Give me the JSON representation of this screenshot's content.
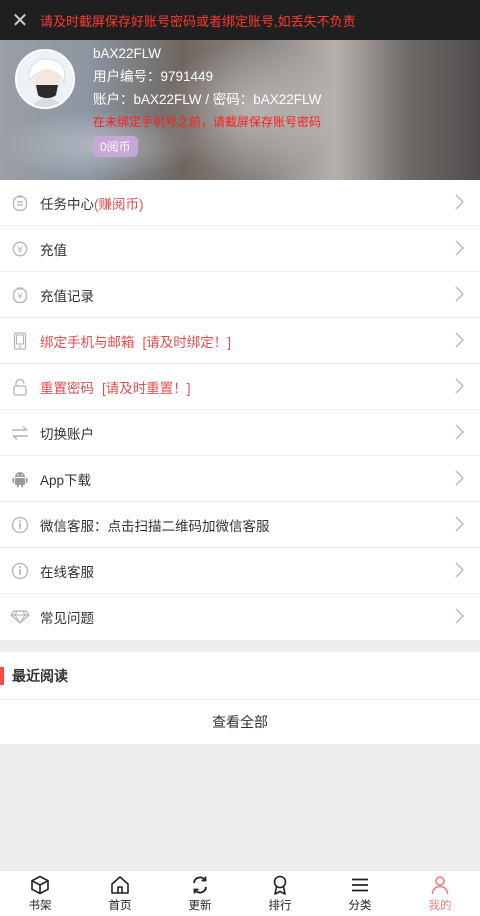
{
  "banner": {
    "text": "请及时截屏保存好账号密码或者绑定账号,如丢失不负责"
  },
  "profile": {
    "username": "bAX22FLW",
    "user_id_line": "用户编号：9791449",
    "account_line": "账户：bAX22FLW / 密码：bAX22FLW",
    "warning": "在未绑定手机号之前，请截屏保存账号密码",
    "coins": "0阅币"
  },
  "menu": [
    {
      "label": "任务中心",
      "hint": "(赚阅币)",
      "icon": "task-icon"
    },
    {
      "label": "充值",
      "hint": "",
      "icon": "yuan-coin-icon"
    },
    {
      "label": "充值记录",
      "hint": "",
      "icon": "recharge-record-icon"
    },
    {
      "label": "绑定手机与邮箱",
      "hint": "[请及时绑定！]",
      "icon": "phone-icon"
    },
    {
      "label": "重置密码",
      "hint": "[请及时重置！]",
      "icon": "unlock-icon"
    },
    {
      "label": "切换账户",
      "hint": "",
      "icon": "switch-arrows-icon"
    },
    {
      "label": "App下载",
      "hint": "",
      "icon": "android-icon"
    },
    {
      "label": "微信客服：点击扫描二维码加微信客服",
      "hint": "",
      "icon": "info-icon"
    },
    {
      "label": "在线客服",
      "hint": "",
      "icon": "info-icon"
    },
    {
      "label": "常见问题",
      "hint": "",
      "icon": "diamond-icon"
    }
  ],
  "recent": {
    "title": "最近阅读",
    "view_all": "查看全部"
  },
  "tabs": [
    {
      "label": "书架",
      "icon": "cube-icon"
    },
    {
      "label": "首页",
      "icon": "home-icon"
    },
    {
      "label": "更新",
      "icon": "refresh-icon"
    },
    {
      "label": "排行",
      "icon": "medal-icon"
    },
    {
      "label": "分类",
      "icon": "menu-icon"
    },
    {
      "label": "我的",
      "icon": "user-icon",
      "active": true
    }
  ],
  "colors": {
    "accent": "#f07f7f",
    "warning_red": "#ff1e1e",
    "coin_badge": "#c8a6d8"
  }
}
